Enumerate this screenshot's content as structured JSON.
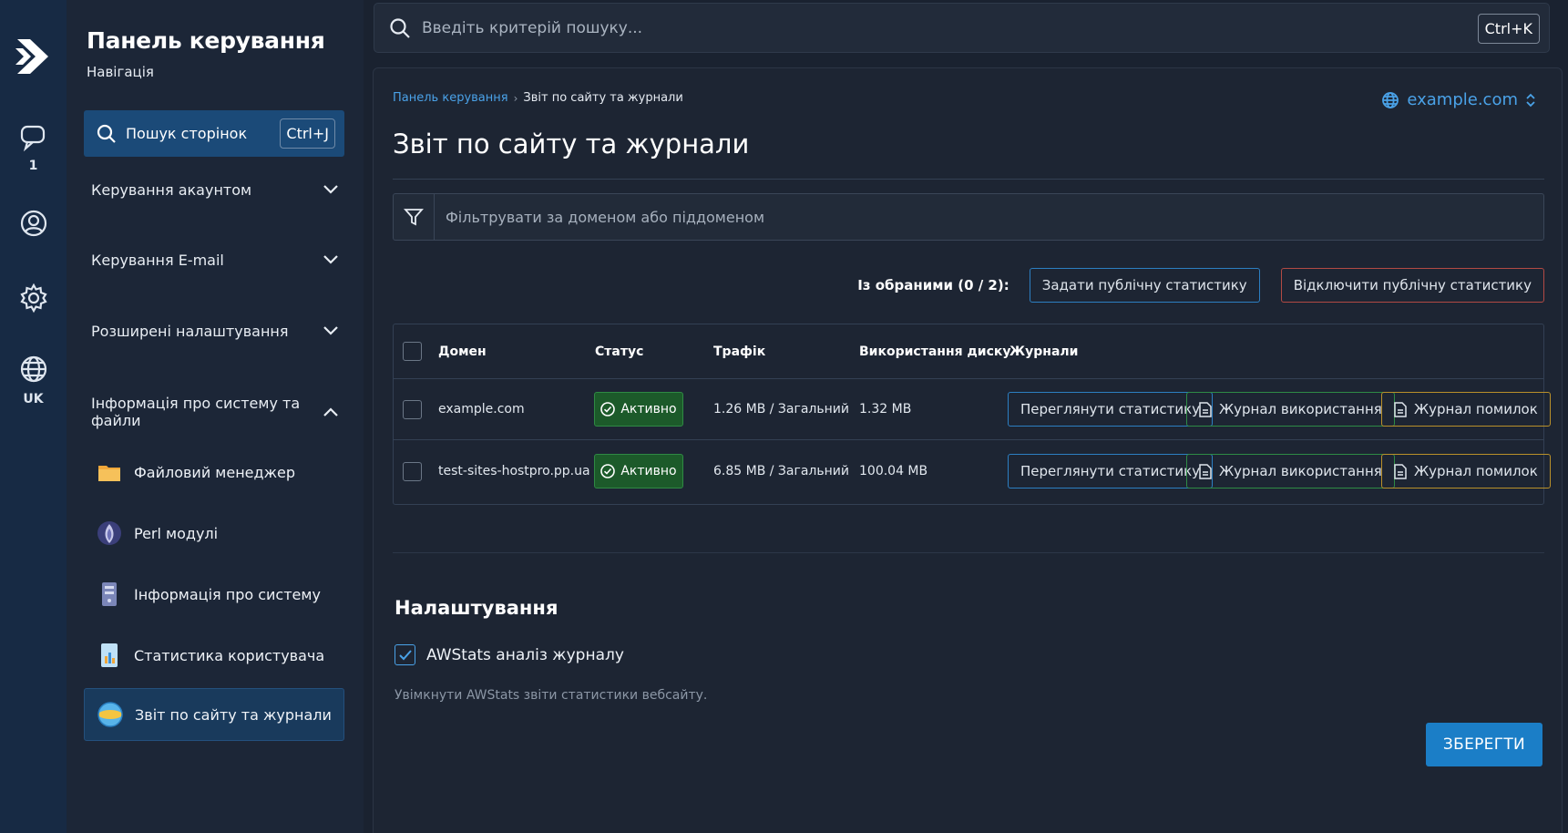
{
  "rail": {
    "notifications_count": "1",
    "language": "UK"
  },
  "sidebar": {
    "title": "Панель керування",
    "subtitle": "Навігація",
    "search_label": "Пошук сторінок",
    "search_shortcut": "Ctrl+J",
    "groups": [
      {
        "label": "Керування акаунтом",
        "expanded": false
      },
      {
        "label": "Керування E-mail",
        "expanded": false
      },
      {
        "label": "Розширені налаштування",
        "expanded": false
      },
      {
        "label": "Інформація про систему та файли",
        "expanded": true
      }
    ],
    "items": [
      {
        "label": "Файловий менеджер",
        "icon": "folder-icon"
      },
      {
        "label": "Perl модулі",
        "icon": "perl-onion-icon"
      },
      {
        "label": "Інформація про систему",
        "icon": "server-icon"
      },
      {
        "label": "Статистика користувача",
        "icon": "chart-file-icon"
      },
      {
        "label": "Звіт по сайту та журнали",
        "icon": "stats-globe-icon",
        "active": true
      }
    ]
  },
  "topbar": {
    "search_placeholder": "Введіть критерій пошуку...",
    "shortcut": "Ctrl+K"
  },
  "main": {
    "breadcrumb": {
      "root": "Панель керування",
      "current": "Звіт по сайту та журнали"
    },
    "domain_selector": "example.com",
    "title": "Звіт по сайту та журнали",
    "filter_placeholder": "Фільтрувати за доменом або піддоменом",
    "selection_label": "Із обраними (0 / 2):",
    "set_public_stats": "Задати публічну статистику",
    "disable_public_stats": "Відключити публічну статистику",
    "table": {
      "headers": {
        "domain": "Домен",
        "status": "Статус",
        "traffic": "Трафік",
        "disk": "Використання диску",
        "logs": "Журнали"
      },
      "rows": [
        {
          "domain": "example.com",
          "status": "Активно",
          "traffic": "1.26 MB / Загальний",
          "disk": "1.32 MB",
          "view_stats": "Переглянути статистику",
          "usage_log": "Журнал використання",
          "error_log": "Журнал помилок"
        },
        {
          "domain": "test-sites-hostpro.pp.ua",
          "status": "Активно",
          "traffic": "6.85 MB / Загальний",
          "disk": "100.04 MB",
          "view_stats": "Переглянути статистику",
          "usage_log": "Журнал використання",
          "error_log": "Журнал помилок"
        }
      ]
    },
    "settings": {
      "title": "Налаштування",
      "awstats_label": "AWStats аналіз журналу",
      "awstats_checked": true,
      "awstats_desc": "Увімкнути AWStats звіти статистики вебсайту.",
      "save": "ЗБЕРЕГТИ"
    }
  },
  "colors": {
    "accent": "#1b7ec7",
    "link": "#4aa2e8",
    "status_active": "#1c5a2a",
    "danger": "#b24a44",
    "warning": "#b9902a"
  }
}
